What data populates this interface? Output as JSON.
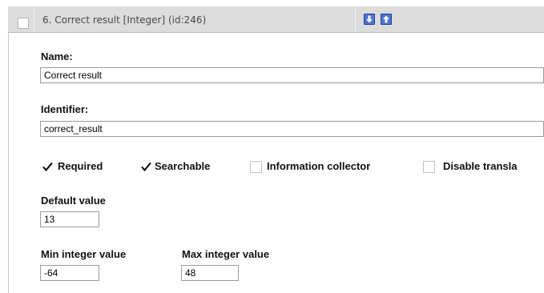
{
  "attribute": {
    "header_title": "6. Correct result [Integer] (id:246)",
    "name_label": "Name:",
    "name_value": "Correct result",
    "identifier_label": "Identifier:",
    "identifier_value": "correct_result",
    "options": [
      {
        "label": "Required",
        "checked": true
      },
      {
        "label": "Searchable",
        "checked": true
      },
      {
        "label": "Information collector",
        "checked": false
      },
      {
        "label": "Disable transla",
        "checked": false
      }
    ],
    "default_value_label": "Default value",
    "default_value": "13",
    "min_label": "Min integer value",
    "min_value": "-64",
    "max_label": "Max integer value",
    "max_value": "48"
  },
  "icons": {
    "move_down": "arrow-down-icon",
    "move_up": "arrow-up-icon"
  },
  "colors": {
    "header_bg": "#dcdcdc",
    "arrow_blue": "#4a76d3"
  }
}
